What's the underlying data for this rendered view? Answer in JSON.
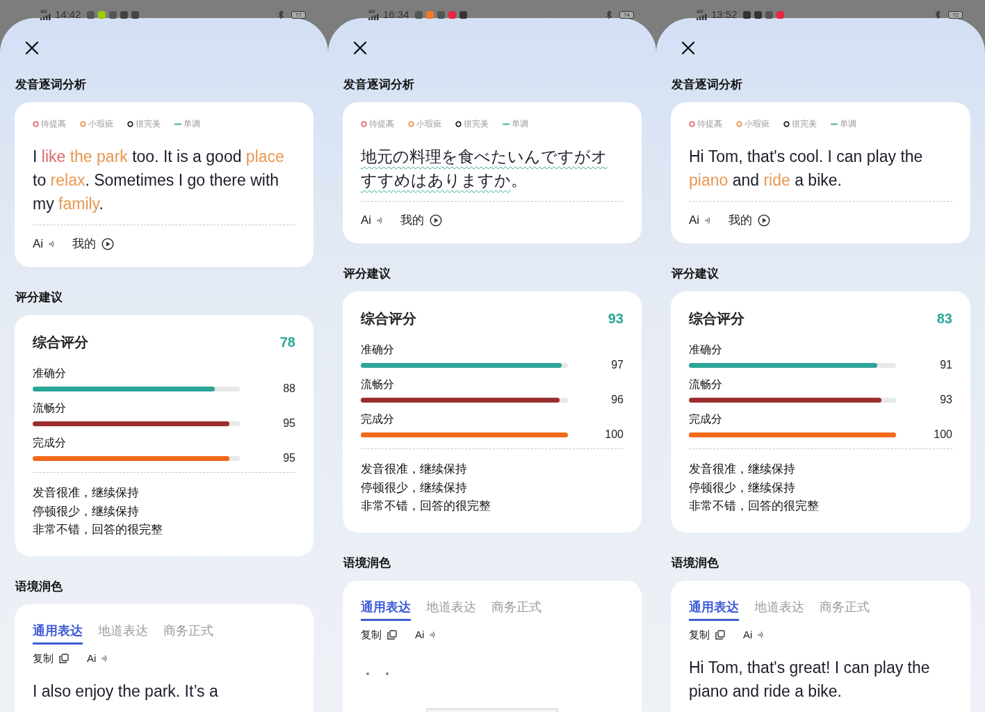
{
  "screens": [
    {
      "status_bar": {
        "network": "4G",
        "time": "14:42",
        "notifications": [
          {
            "color": "#555555"
          },
          {
            "color": "#9acd00"
          },
          {
            "color": "#555555"
          },
          {
            "color": "#444444"
          },
          {
            "color": "#444444"
          }
        ],
        "battery": "77"
      },
      "word_analysis": {
        "title": "发音逐词分析",
        "legend": [
          {
            "label": "待提高",
            "kind": "circle",
            "color": "#e06a6a"
          },
          {
            "label": "小瑕疵",
            "kind": "circle",
            "color": "#e8974f"
          },
          {
            "label": "很完美",
            "kind": "circle",
            "color": "#222222"
          },
          {
            "label": "单调",
            "kind": "dash",
            "color": "#2ba597"
          }
        ],
        "sentence": [
          {
            "text": "I ",
            "kind": "normal"
          },
          {
            "text": "like",
            "kind": "poor"
          },
          {
            "text": " the park",
            "kind": "minor"
          },
          {
            "text": " too. It is a good ",
            "kind": "normal"
          },
          {
            "text": "place",
            "kind": "minor"
          },
          {
            "text": " to ",
            "kind": "normal"
          },
          {
            "text": "relax",
            "kind": "minor"
          },
          {
            "text": ". Sometimes I go there with my ",
            "kind": "normal"
          },
          {
            "text": "family",
            "kind": "minor"
          },
          {
            "text": ".",
            "kind": "normal"
          }
        ],
        "ai_label": "Ai",
        "mine_label": "我的"
      },
      "scoring": {
        "title": "评分建议",
        "total_label": "综合评分",
        "total": "78",
        "metrics": [
          {
            "label": "准确分",
            "value": "88",
            "level": 0.88,
            "color": "#2ba597"
          },
          {
            "label": "流畅分",
            "value": "95",
            "level": 0.95,
            "color": "#9b2f2f"
          },
          {
            "label": "完成分",
            "value": "95",
            "level": 0.95,
            "color": "#f26a1b"
          }
        ],
        "feedback": [
          "发音很准，继续保持",
          "停顿很少，继续保持",
          "非常不错，回答的很完整"
        ]
      },
      "polish": {
        "title": "语境润色",
        "tabs": [
          {
            "label": "通用表达",
            "selected": true
          },
          {
            "label": "地道表达",
            "selected": false
          },
          {
            "label": "商务正式",
            "selected": false
          }
        ],
        "copy_label": "复制",
        "ai_label": "Ai",
        "content": {
          "kind": "text",
          "text": "I also enjoy the park. It’s a"
        }
      }
    },
    {
      "status_bar": {
        "network": "4G",
        "time": "16:34",
        "notifications": [
          {
            "color": "#555555"
          },
          {
            "color": "#f07a2a"
          },
          {
            "color": "#555555"
          },
          {
            "color": "#e8283f"
          },
          {
            "color": "#333333"
          }
        ],
        "battery": "74"
      },
      "word_analysis": {
        "title": "发音逐词分析",
        "legend": [
          {
            "label": "待提高",
            "kind": "circle",
            "color": "#e06a6a"
          },
          {
            "label": "小瑕疵",
            "kind": "circle",
            "color": "#e8974f"
          },
          {
            "label": "很完美",
            "kind": "circle",
            "color": "#222222"
          },
          {
            "label": "单调",
            "kind": "dash",
            "color": "#2ba597"
          }
        ],
        "sentence": [
          {
            "text": "地元の料理を食べたいんですがオすすめはありますか",
            "kind": "monotone"
          },
          {
            "text": "。",
            "kind": "normal"
          }
        ],
        "ai_label": "Ai",
        "mine_label": "我的"
      },
      "scoring": {
        "title": "评分建议",
        "total_label": "综合评分",
        "total": "93",
        "metrics": [
          {
            "label": "准确分",
            "value": "97",
            "level": 0.97,
            "color": "#2ba597"
          },
          {
            "label": "流畅分",
            "value": "96",
            "level": 0.96,
            "color": "#9b2f2f"
          },
          {
            "label": "完成分",
            "value": "100",
            "level": 1.0,
            "color": "#f26a1b"
          }
        ],
        "feedback": [
          "发音很准，继续保持",
          "停顿很少，继续保持",
          "非常不错，回答的很完整"
        ]
      },
      "polish": {
        "title": "语境润色",
        "tabs": [
          {
            "label": "通用表达",
            "selected": true
          },
          {
            "label": "地道表达",
            "selected": false
          },
          {
            "label": "商务正式",
            "selected": false
          }
        ],
        "copy_label": "复制",
        "ai_label": "Ai",
        "content": {
          "kind": "loading"
        }
      },
      "home_indicator": true
    },
    {
      "status_bar": {
        "network": "4G",
        "time": "13:52",
        "notifications": [
          {
            "color": "#333333"
          },
          {
            "color": "#333333"
          },
          {
            "color": "#555555"
          },
          {
            "color": "#e8283f"
          }
        ],
        "battery": "72"
      },
      "word_analysis": {
        "title": "发音逐词分析",
        "legend": [
          {
            "label": "待提高",
            "kind": "circle",
            "color": "#e06a6a"
          },
          {
            "label": "小瑕疵",
            "kind": "circle",
            "color": "#e8974f"
          },
          {
            "label": "很完美",
            "kind": "circle",
            "color": "#222222"
          },
          {
            "label": "单调",
            "kind": "dash",
            "color": "#2ba597"
          }
        ],
        "sentence": [
          {
            "text": "Hi Tom, that's cool. I can play the ",
            "kind": "normal"
          },
          {
            "text": "piano",
            "kind": "minor"
          },
          {
            "text": " and ",
            "kind": "normal"
          },
          {
            "text": "ride",
            "kind": "minor"
          },
          {
            "text": " a bike.",
            "kind": "normal"
          }
        ],
        "ai_label": "Ai",
        "mine_label": "我的"
      },
      "scoring": {
        "title": "评分建议",
        "total_label": "综合评分",
        "total": "83",
        "metrics": [
          {
            "label": "准确分",
            "value": "91",
            "level": 0.91,
            "color": "#2ba597"
          },
          {
            "label": "流畅分",
            "value": "93",
            "level": 0.93,
            "color": "#9b2f2f"
          },
          {
            "label": "完成分",
            "value": "100",
            "level": 1.0,
            "color": "#f26a1b"
          }
        ],
        "feedback": [
          "发音很准，继续保持",
          "停顿很少，继续保持",
          "非常不错，回答的很完整"
        ]
      },
      "polish": {
        "title": "语境润色",
        "tabs": [
          {
            "label": "通用表达",
            "selected": true
          },
          {
            "label": "地道表达",
            "selected": false
          },
          {
            "label": "商务正式",
            "selected": false
          }
        ],
        "copy_label": "复制",
        "ai_label": "Ai",
        "content": {
          "kind": "text",
          "text": "Hi Tom, that's great! I can play the piano and ride a bike."
        }
      }
    }
  ]
}
